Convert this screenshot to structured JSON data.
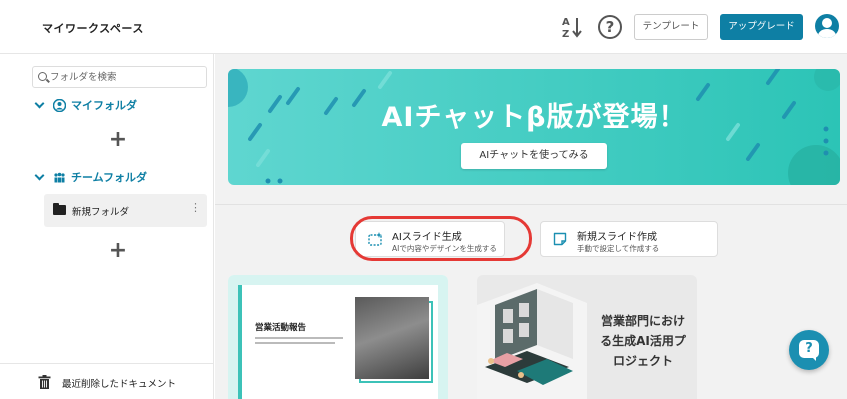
{
  "header": {
    "workspace_title": "マイワークスペース",
    "sort_icon": "sort-az-icon",
    "help_icon_glyph": "?",
    "template_label": "テンプレート",
    "upgrade_label": "アップグレード",
    "avatar_icon": "user-avatar-icon"
  },
  "sidebar": {
    "search_placeholder": "フォルダを検索",
    "my_folder_label": "マイフォルダ",
    "team_folder_label": "チームフォルダ",
    "plus_glyph": "+",
    "folder_item_label": "新規フォルダ",
    "folder_menu_glyph": "⋮",
    "trash_label": "最近削除したドキュメント"
  },
  "banner": {
    "title": "AIチャットβ版が登場！",
    "button_label": "AIチャットを使ってみる"
  },
  "actions": {
    "ai_slide": {
      "title": "AIスライド生成",
      "subtitle": "AIで内容やデザインを生成する"
    },
    "new_slide": {
      "title": "新規スライド作成",
      "subtitle": "手動で設定して作成する"
    }
  },
  "documents": [
    {
      "title": "営業活動報告"
    },
    {
      "title": "営業部門における生成AI活用プロジェクト"
    }
  ],
  "chat_fab_glyph": "?",
  "colors": {
    "brand": "#0e7fa4",
    "banner_start": "#5fd6d0",
    "banner_end": "#2cc4b6",
    "highlight": "#e53935",
    "accent_teal": "#3cc2b8"
  }
}
